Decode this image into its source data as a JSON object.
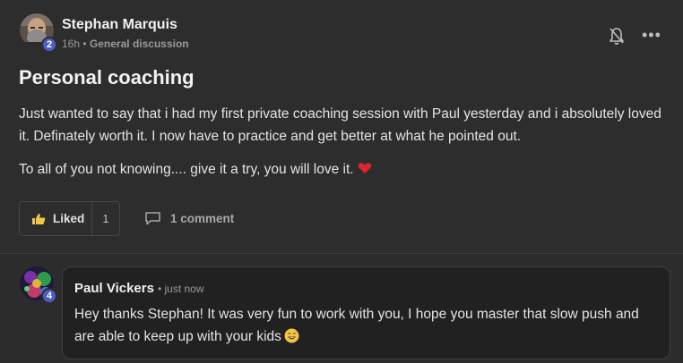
{
  "post": {
    "author": "Stephan Marquis",
    "author_level": "2",
    "time": "16h",
    "separator": "•",
    "category": "General discussion",
    "title": "Personal coaching",
    "paragraphs": [
      "Just wanted to say that i had my first private coaching session with Paul yesterday and i absolutely loved it. Definately worth it. I now have to practice and get better at what he pointed out.",
      "To all of you not knowing.... give it a try, you will love it."
    ],
    "like_label": "Liked",
    "like_count": "1",
    "comments_label": "1 comment",
    "more_label": "•••"
  },
  "comment": {
    "author": "Paul Vickers",
    "author_level": "4",
    "time": "• just now",
    "text": "Hey thanks Stephan! It was very fun to work with you, I hope you master that slow push and are able to keep up with your kids"
  },
  "colors": {
    "background": "#2d2d2d",
    "level_badge": "#4d5cc4",
    "heart": "#e0242c",
    "thumb": "#f0c64a"
  },
  "icons": {
    "bell": "bell-icon",
    "more": "more-options-icon",
    "heart": "heart-emoji-icon",
    "thumb": "thumbs-up-icon",
    "comment": "comment-bubble-icon",
    "laugh": "grinning-sweat-emoji-icon"
  }
}
